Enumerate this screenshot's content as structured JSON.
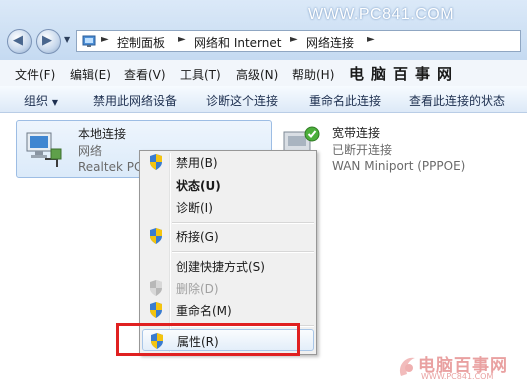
{
  "watermark_top": "WWW.PC841.COM",
  "address_bar": {
    "crumbs": [
      "控制面板",
      "网络和 Internet",
      "网络连接"
    ]
  },
  "menubar": {
    "items": [
      "文件(F)",
      "编辑(E)",
      "查看(V)",
      "工具(T)",
      "高级(N)",
      "帮助(H)"
    ],
    "brand": "电脑百事网"
  },
  "command_bar": {
    "organize": "组织",
    "disable_device": "禁用此网络设备",
    "diagnose": "诊断这个连接",
    "rename": "重命名此连接",
    "view_status": "查看此连接的状态"
  },
  "connections": [
    {
      "name": "本地连接",
      "status": "网络",
      "device": "Realtek PC"
    },
    {
      "name": "宽带连接",
      "status": "已断开连接",
      "device": "WAN Miniport (PPPOE)"
    }
  ],
  "context_menu": {
    "items": [
      {
        "label": "禁用(B)",
        "icon": "shield-icon"
      },
      {
        "label": "状态(U)",
        "bold": true
      },
      {
        "label": "诊断(I)"
      },
      {
        "label": "桥接(G)",
        "icon": "shield-icon"
      },
      {
        "label": "创建快捷方式(S)"
      },
      {
        "label": "删除(D)",
        "disabled": true,
        "icon": "shield-icon"
      },
      {
        "label": "重命名(M)",
        "icon": "shield-icon"
      },
      {
        "label": "属性(R)",
        "icon": "shield-icon",
        "highlighted": true
      }
    ]
  },
  "watermark_bottom": {
    "text": "电脑百事网",
    "url": "WWW.PC841.COM"
  },
  "colors": {
    "highlight_box": "#e02020",
    "watermark": "#e9a1a1"
  }
}
